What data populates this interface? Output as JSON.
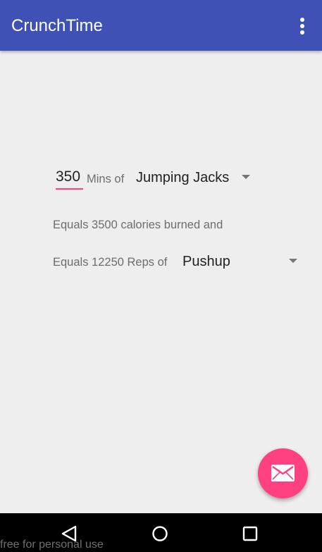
{
  "app": {
    "title": "CrunchTime"
  },
  "icons": {
    "overflow": "more-vert-icon",
    "fab": "email-icon",
    "back": "back-icon",
    "home": "home-icon",
    "recent": "recent-apps-icon"
  },
  "form": {
    "minutes_value": "350",
    "minutes_label": "Mins of",
    "exercise_selected": "Jumping Jacks",
    "calories_text": "Equals 3500 calories burned and",
    "reps_text": "Equals 12250 Reps of",
    "target_selected": "Pushup"
  },
  "watermark": "free for personal use",
  "colors": {
    "primary": "#3f51b5",
    "accent": "#ff4081",
    "background": "#eeeeee"
  }
}
